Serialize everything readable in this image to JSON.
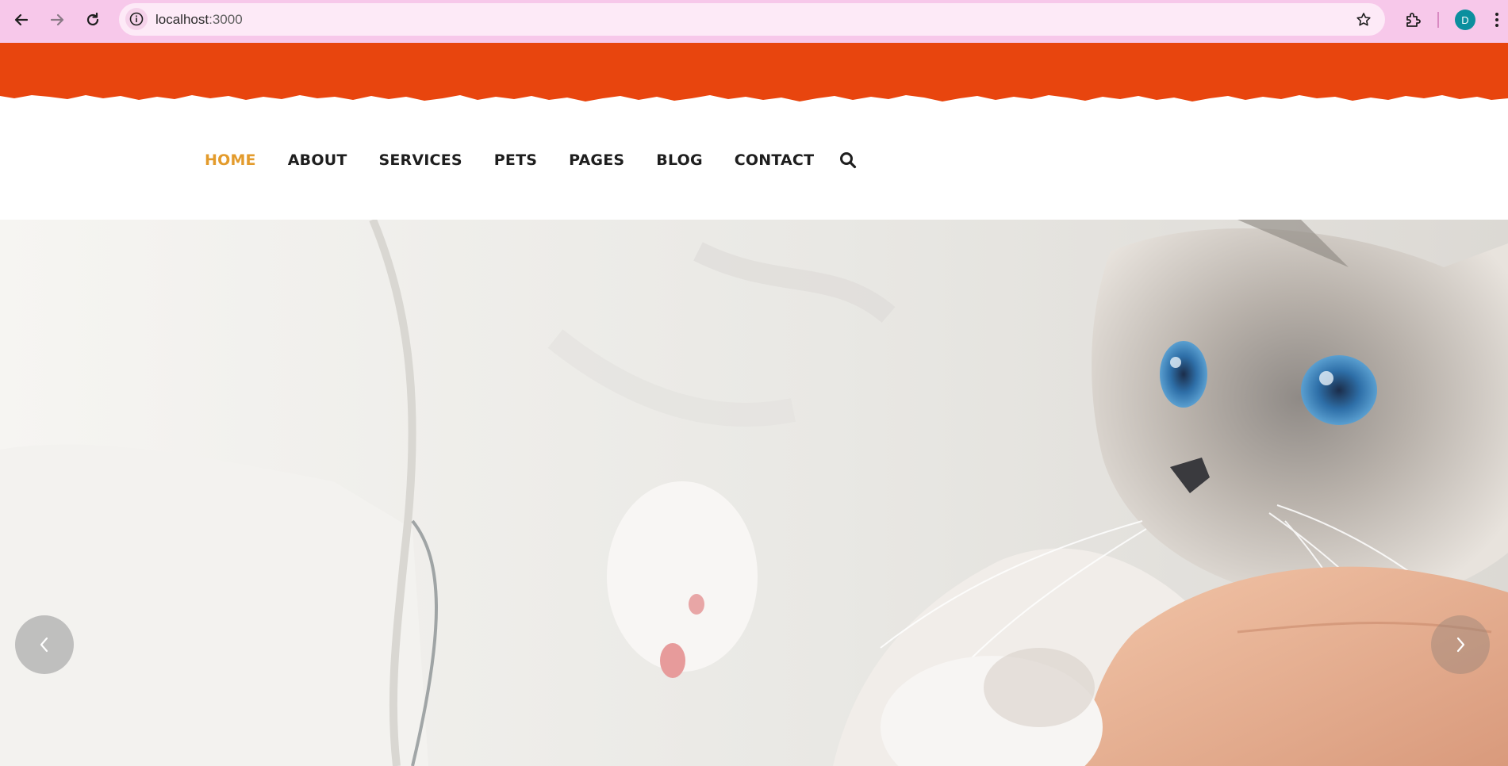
{
  "browser": {
    "url_host": "localhost",
    "url_port": ":3000",
    "profile_initial": "D",
    "icons": {
      "back": "arrow-left-icon",
      "forward": "arrow-right-icon",
      "reload": "reload-icon",
      "site_info": "info-icon",
      "bookmark": "star-icon",
      "extensions": "puzzle-icon",
      "menu": "kebab-menu-icon"
    }
  },
  "site": {
    "colors": {
      "top_band": "#e8450e",
      "nav_active": "#e39b2c",
      "nav_text": "#1e1e1e"
    },
    "nav": {
      "items": [
        {
          "label": "HOME",
          "active": true
        },
        {
          "label": "ABOUT",
          "active": false
        },
        {
          "label": "SERVICES",
          "active": false
        },
        {
          "label": "PETS",
          "active": false
        },
        {
          "label": "PAGES",
          "active": false
        },
        {
          "label": "BLOG",
          "active": false
        },
        {
          "label": "CONTACT",
          "active": false
        }
      ],
      "search_icon": "search-icon"
    },
    "hero": {
      "image": "Blue-eyed ragdoll cat held in a person's arm against a white sweater",
      "prev_icon": "chevron-left-icon",
      "next_icon": "chevron-right-icon"
    }
  }
}
